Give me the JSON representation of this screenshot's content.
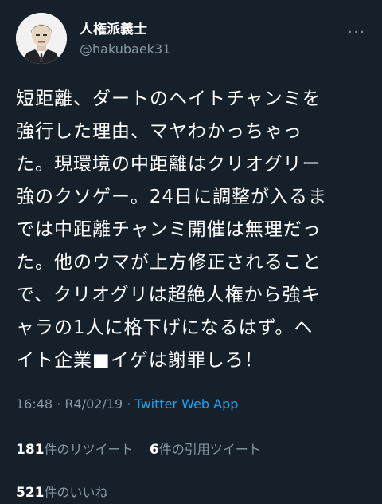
{
  "user": {
    "display_name": "人権派義士",
    "handle": "@hakubaek31"
  },
  "more_label": "···",
  "tweet_text": "短距離、ダートのヘイトチャンミを\n強行した理由、マヤわかっちゃっ\nた。現環境の中距離はクリオグリー\n強のクソゲー。24日に調整が入るま\nでは中距離チャンミ開催は無理だっ\nた。他のウマが上方修正されること\nで、クリオグリは超絶人権から強キ\nャラの1人に格下げになるはず。ヘ\nイト企業■イゲは謝罪しろ！",
  "meta": {
    "time": "16:48",
    "date": "R4/02/19",
    "separator": "·",
    "app": "Twitter Web App"
  },
  "stats": {
    "retweets_count": "181",
    "retweets_label": "件のリツイート",
    "quotes_count": "6",
    "quotes_label": "件の引用ツイート",
    "likes_count": "521",
    "likes_label": "件のいいね"
  }
}
